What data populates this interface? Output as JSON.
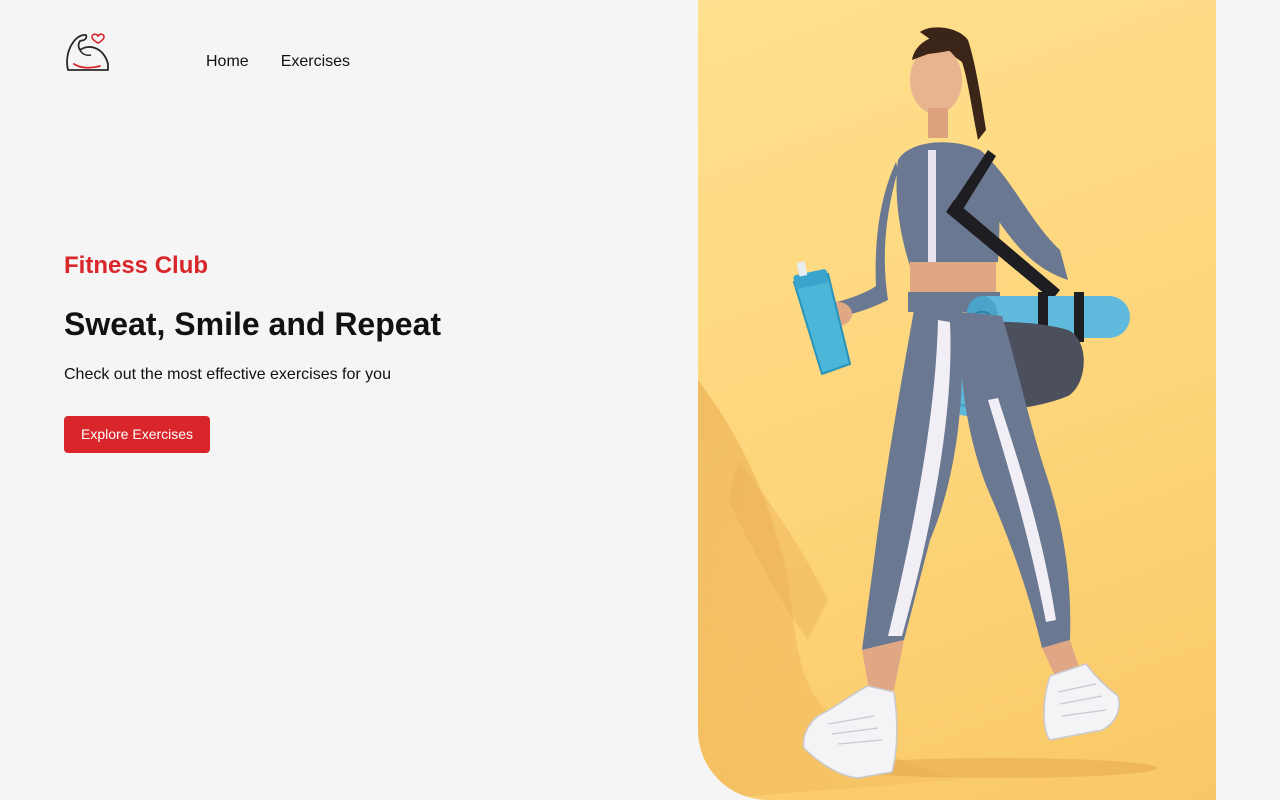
{
  "nav": {
    "logo_icon": "flexed-bicep-heart-icon",
    "links": [
      {
        "label": "Home"
      },
      {
        "label": "Exercises"
      }
    ]
  },
  "hero": {
    "eyebrow": "Fitness Club",
    "title": "Sweat, Smile and Repeat",
    "subtitle": "Check out the most effective exercises for you",
    "cta_label": "Explore Exercises"
  },
  "banner": {
    "image": "woman-walking-with-yoga-mat-and-shaker-photo"
  },
  "colors": {
    "accent": "#d8262b",
    "background": "#f5f5f5",
    "image_bg": "#fdd57a"
  }
}
